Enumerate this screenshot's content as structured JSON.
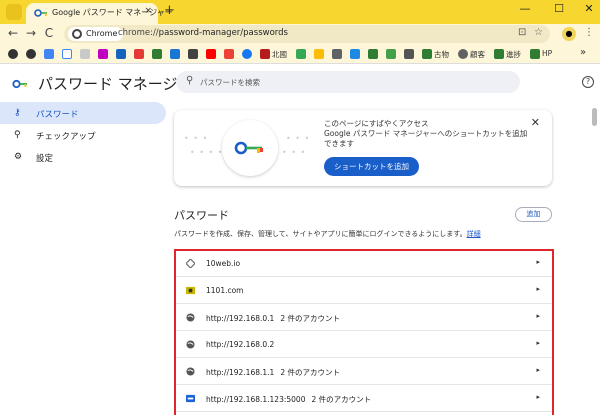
{
  "tab": {
    "title": "Google パスワード マネージャー",
    "close": "×"
  },
  "newtab": "+",
  "window_controls": {
    "minimize": "—",
    "maximize": "☐",
    "close": "✕"
  },
  "toolbar": {
    "back": "←",
    "forward": "→",
    "reload": "C",
    "chip_label": "Chrome",
    "url_prefix": "chrome://",
    "url_path": "password-manager/passwords",
    "cast": "⊡",
    "star": "☆",
    "avatar": "●",
    "menu": "⋮"
  },
  "bookmarks": [
    {
      "label": "北國",
      "color": "#b71c1c"
    },
    {
      "label": "古物",
      "color": "#2e7d32"
    },
    {
      "label": "顧客",
      "color": "#616161"
    },
    {
      "label": "進捗",
      "color": "#2e7d32"
    },
    {
      "label": "HP",
      "color": "#2e7d32"
    }
  ],
  "bookmarks_more": "»",
  "header": {
    "title": "パスワード マネージャー",
    "search_placeholder": "パスワードを検索",
    "search_icon": "⚲",
    "help_icon": "?"
  },
  "nav": [
    {
      "label": "パスワード",
      "icon": "⚷"
    },
    {
      "label": "チェックアップ",
      "icon": "⚲"
    },
    {
      "label": "設定",
      "icon": "⚙"
    }
  ],
  "promo": {
    "line1": "このページにすばやくアクセス",
    "line2": "Google パスワード マネージャーへのショートカットを追加できます",
    "button": "ショートカットを追加",
    "close": "✕"
  },
  "passwords": {
    "title": "パスワード",
    "add": "追加",
    "description": "パスワードを作成、保存、管理して、サイトやアプリに簡単にログインできるようにします。",
    "details_link": "詳細",
    "items": [
      {
        "site": "10web.io",
        "count": "",
        "icon_color": "#777"
      },
      {
        "site": "1101.com",
        "count": "",
        "icon_color": "#c9b800"
      },
      {
        "site": "http://192.168.0.1",
        "count": "2 件のアカウント",
        "icon_color": "#555"
      },
      {
        "site": "http://192.168.0.2",
        "count": "",
        "icon_color": "#555"
      },
      {
        "site": "http://192.168.1.1",
        "count": "2 件のアカウント",
        "icon_color": "#555"
      },
      {
        "site": "http://192.168.1.123:5000",
        "count": "2 件のアカウント",
        "icon_color": "#1e63d6"
      }
    ],
    "chevron": "▸"
  },
  "colors": {
    "accent": "#1a5ec9",
    "highlight": "#e0262c",
    "frame": "#f8d630"
  }
}
